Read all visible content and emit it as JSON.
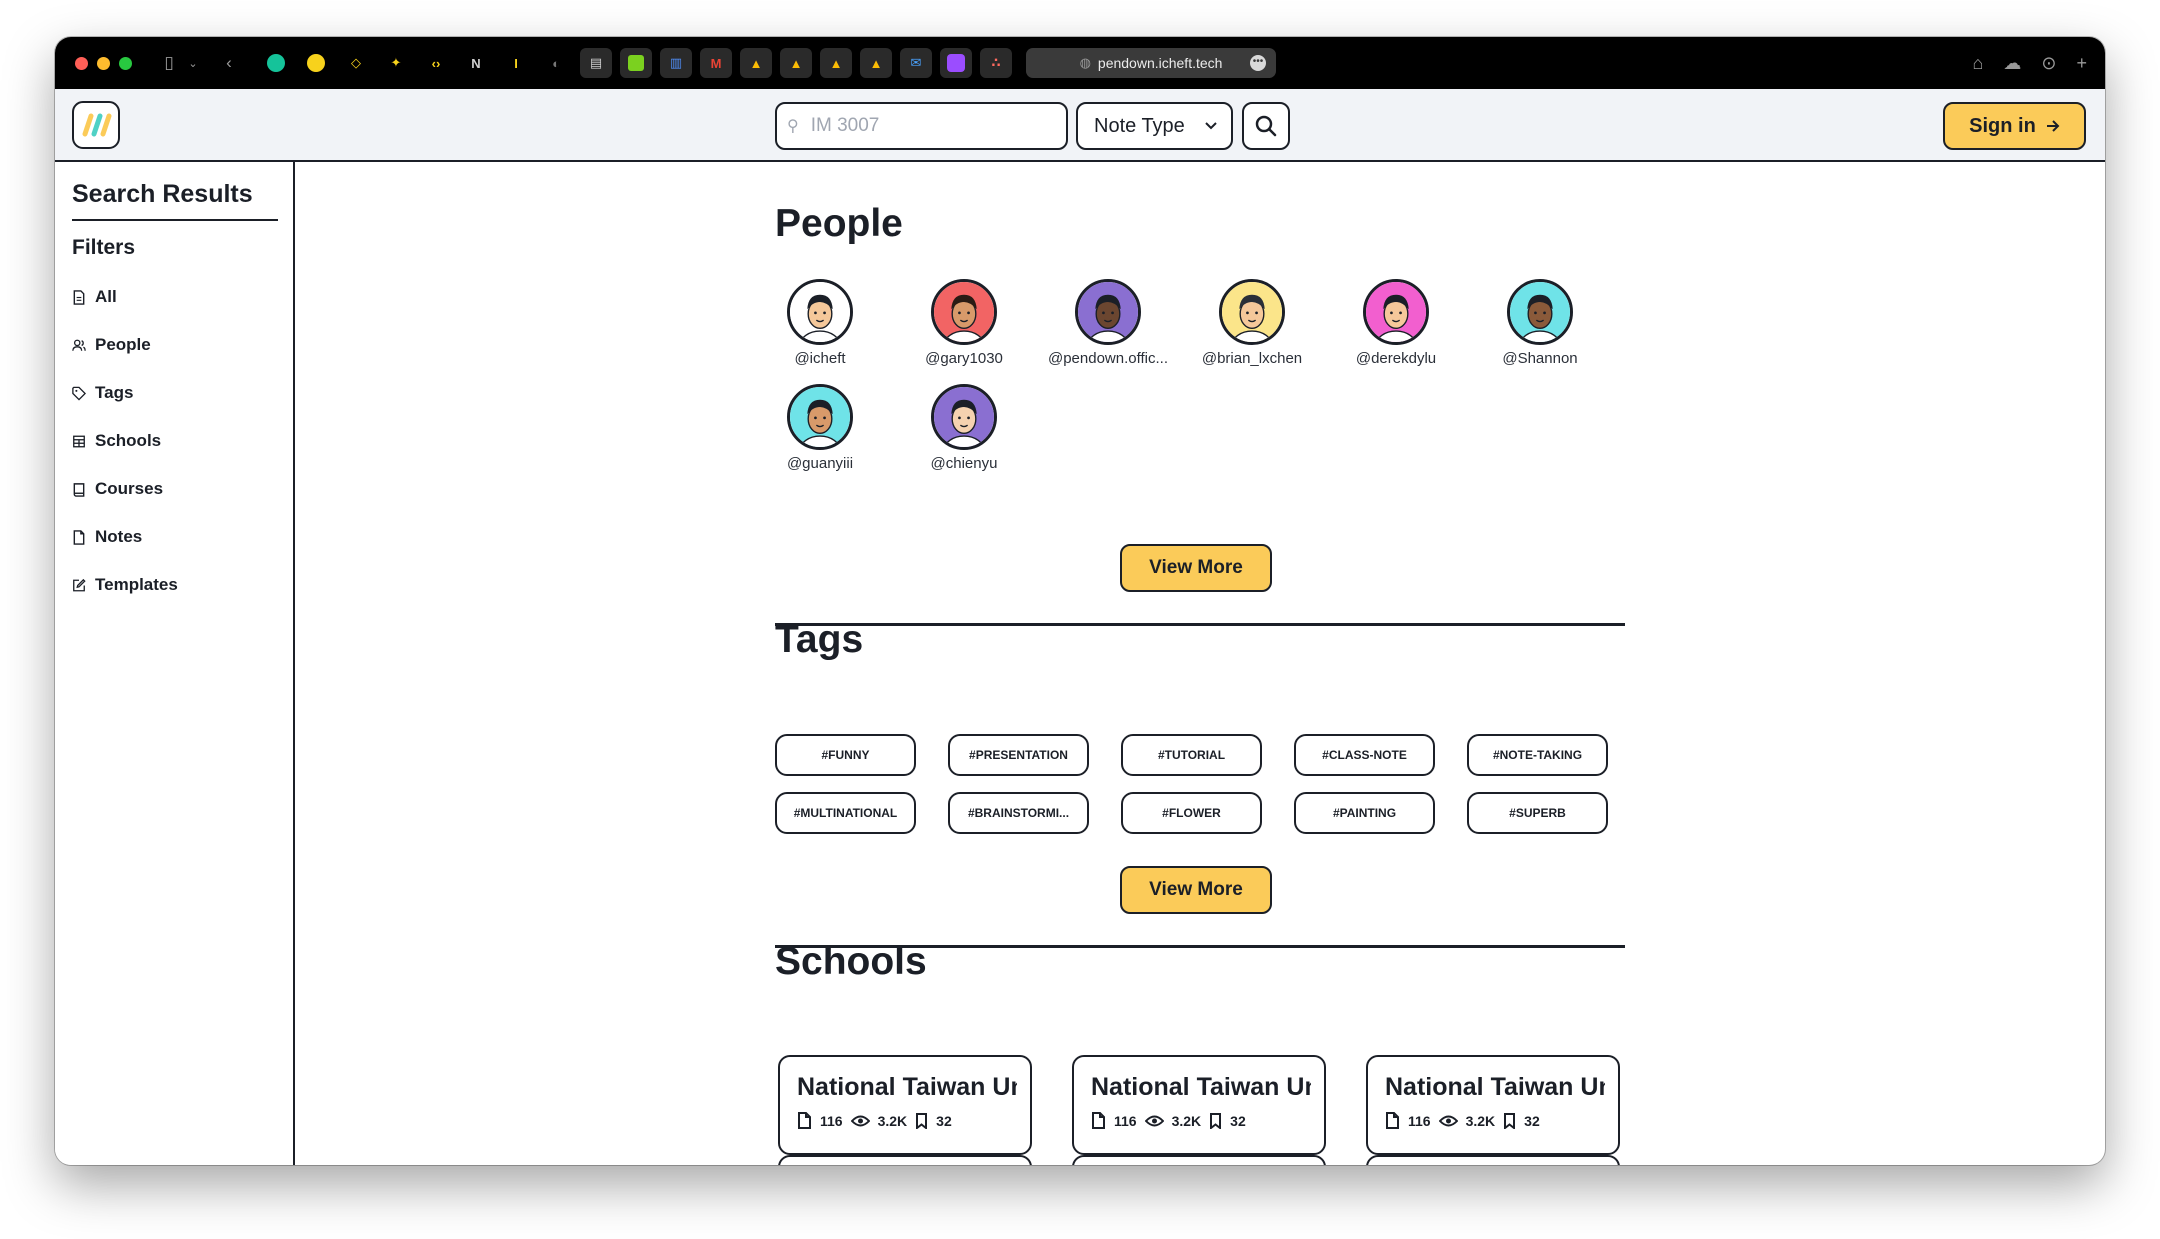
{
  "browser": {
    "url": "pendown.icheft.tech"
  },
  "header": {
    "search_placeholder": "IM 3007",
    "note_type_label": "Note Type",
    "signin_label": "Sign in",
    "signin_icon": "arrow-right-icon"
  },
  "sidebar": {
    "title": "Search Results",
    "filters_label": "Filters",
    "items": [
      {
        "label": "All",
        "icon": "file-icon"
      },
      {
        "label": "People",
        "icon": "users-icon"
      },
      {
        "label": "Tags",
        "icon": "tag-icon"
      },
      {
        "label": "Schools",
        "icon": "school-icon"
      },
      {
        "label": "Courses",
        "icon": "book-icon"
      },
      {
        "label": "Notes",
        "icon": "note-icon"
      },
      {
        "label": "Templates",
        "icon": "edit-icon"
      }
    ]
  },
  "people": {
    "heading": "People",
    "users": [
      {
        "handle": "@icheft",
        "bg": "#ffffff",
        "skin": "#f5c89a",
        "hair": "#1b1f27"
      },
      {
        "handle": "@gary1030",
        "bg": "#f26464",
        "skin": "#d89a6a",
        "hair": "#2a1b14"
      },
      {
        "handle": "@pendown.offic...",
        "bg": "#8a6fd1",
        "skin": "#6b4630",
        "hair": "#1b1f27"
      },
      {
        "handle": "@brian_lxchen",
        "bg": "#fbe58a",
        "skin": "#f5c89a",
        "hair": "#2a2f38"
      },
      {
        "handle": "@derekdylu",
        "bg": "#f25fcf",
        "skin": "#f5c89a",
        "hair": "#1b1f27"
      },
      {
        "handle": "@Shannon",
        "bg": "#6fe3e8",
        "skin": "#8a5a3a",
        "hair": "#1b1f27"
      },
      {
        "handle": "@guanyiii",
        "bg": "#6fe3e8",
        "skin": "#d89a6a",
        "hair": "#1b1f27"
      },
      {
        "handle": "@chienyu",
        "bg": "#8a6fd1",
        "skin": "#f5d2b0",
        "hair": "#1b1f27"
      }
    ],
    "view_more": "View More"
  },
  "tags": {
    "heading": "Tags",
    "items": [
      "#FUNNY",
      "#PRESENTATION",
      "#TUTORIAL",
      "#CLASS-NOTE",
      "#NOTE-TAKING",
      "#MULTINATIONAL",
      "#BRAINSTORMI...",
      "#FLOWER",
      "#PAINTING",
      "#SUPERB"
    ],
    "view_more": "View More"
  },
  "schools": {
    "heading": "Schools",
    "items": [
      {
        "name": "National Taiwan University",
        "notes": "116",
        "views": "3.2K",
        "saves": "32"
      },
      {
        "name": "National Taiwan University",
        "notes": "116",
        "views": "3.2K",
        "saves": "32"
      },
      {
        "name": "National Taiwan University",
        "notes": "116",
        "views": "3.2K",
        "saves": "32"
      }
    ]
  },
  "colors": {
    "accent": "#fbcb59",
    "ink": "#1b1f27",
    "header_bg": "#f1f3f7"
  }
}
